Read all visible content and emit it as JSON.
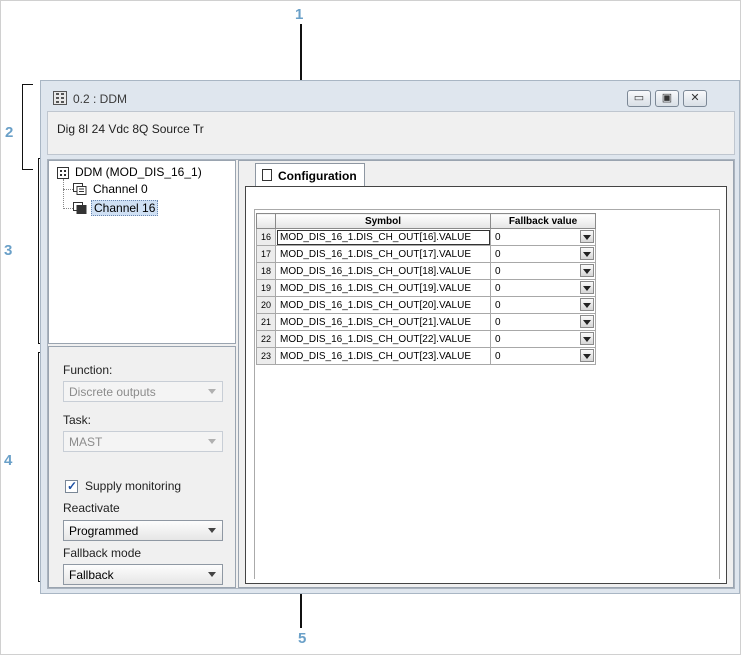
{
  "callouts": [
    "1",
    "2",
    "3",
    "4",
    "5"
  ],
  "window": {
    "title": "0.2 : DDM",
    "description": "Dig 8I 24 Vdc 8Q Source Tr",
    "controls": {
      "minimize": "▭",
      "maximize": "▣",
      "close": "✕"
    }
  },
  "tree": {
    "root": "DDM (MOD_DIS_16_1)",
    "items": [
      {
        "label": "Channel 0",
        "selected": false
      },
      {
        "label": "Channel 16",
        "selected": true
      }
    ]
  },
  "params": {
    "function_label": "Function:",
    "function_value": "Discrete outputs",
    "task_label": "Task:",
    "task_value": "MAST",
    "supply_monitoring_label": "Supply monitoring",
    "supply_monitoring_checked": true,
    "reactivate_label": "Reactivate",
    "reactivate_value": "Programmed",
    "fallback_mode_label": "Fallback mode",
    "fallback_mode_value": "Fallback"
  },
  "tab": {
    "label": "Configuration"
  },
  "table": {
    "headers": [
      "",
      "Symbol",
      "Fallback value"
    ],
    "rows": [
      {
        "index": "16",
        "symbol": "MOD_DIS_16_1.DIS_CH_OUT[16].VALUE",
        "fallback": "0"
      },
      {
        "index": "17",
        "symbol": "MOD_DIS_16_1.DIS_CH_OUT[17].VALUE",
        "fallback": "0"
      },
      {
        "index": "18",
        "symbol": "MOD_DIS_16_1.DIS_CH_OUT[18].VALUE",
        "fallback": "0"
      },
      {
        "index": "19",
        "symbol": "MOD_DIS_16_1.DIS_CH_OUT[19].VALUE",
        "fallback": "0"
      },
      {
        "index": "20",
        "symbol": "MOD_DIS_16_1.DIS_CH_OUT[20].VALUE",
        "fallback": "0"
      },
      {
        "index": "21",
        "symbol": "MOD_DIS_16_1.DIS_CH_OUT[21].VALUE",
        "fallback": "0"
      },
      {
        "index": "22",
        "symbol": "MOD_DIS_16_1.DIS_CH_OUT[22].VALUE",
        "fallback": "0"
      },
      {
        "index": "23",
        "symbol": "MOD_DIS_16_1.DIS_CH_OUT[23].VALUE",
        "fallback": "0"
      }
    ]
  },
  "colors": {
    "callout": "#6aa0c8",
    "window_bg": "#dfe6ee",
    "selection": "#cfe0f4"
  }
}
